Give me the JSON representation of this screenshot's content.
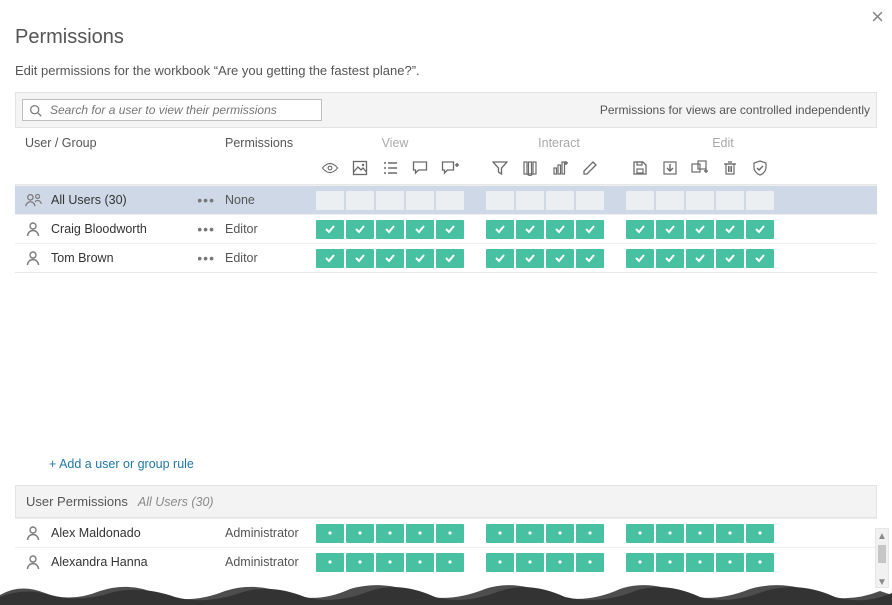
{
  "dialog": {
    "title": "Permissions",
    "subtitle": "Edit permissions for the workbook “Are you getting the fastest plane?”.",
    "close_label": "×"
  },
  "toolbar": {
    "search_placeholder": "Search for a user to view their permissions",
    "notice": "Permissions for views are controlled independently"
  },
  "columns": {
    "user_group": "User / Group",
    "permissions": "Permissions",
    "groups": {
      "view": "View",
      "interact": "Interact",
      "edit": "Edit"
    }
  },
  "capability_icons": {
    "view": [
      "eye-icon",
      "image-icon",
      "list-details-icon",
      "comment-icon",
      "add-comment-icon"
    ],
    "interact": [
      "filter-icon",
      "sort-icon",
      "chart-edit-icon",
      "pen-icon"
    ],
    "edit": [
      "save-icon",
      "download-icon",
      "move-icon",
      "delete-icon",
      "set-permissions-icon"
    ]
  },
  "rules": [
    {
      "name": "All Users (30)",
      "type": "group",
      "template": "None",
      "caps": "empty",
      "selected": true
    },
    {
      "name": "Craig Bloodworth",
      "type": "user",
      "template": "Editor",
      "caps": "check",
      "selected": false
    },
    {
      "name": "Tom Brown",
      "type": "user",
      "template": "Editor",
      "caps": "check",
      "selected": false
    }
  ],
  "add_rule_label": "+ Add a user or group rule",
  "user_perms_section": {
    "title": "User Permissions",
    "scope": "All Users (30)",
    "rows": [
      {
        "name": "Alex Maldonado",
        "template": "Administrator",
        "caps": "dot"
      },
      {
        "name": "Alexandra Hanna",
        "template": "Administrator",
        "caps": "dot"
      }
    ]
  },
  "colors": {
    "accent_green": "#47c1a2",
    "selected_row": "#cfd8e6"
  }
}
